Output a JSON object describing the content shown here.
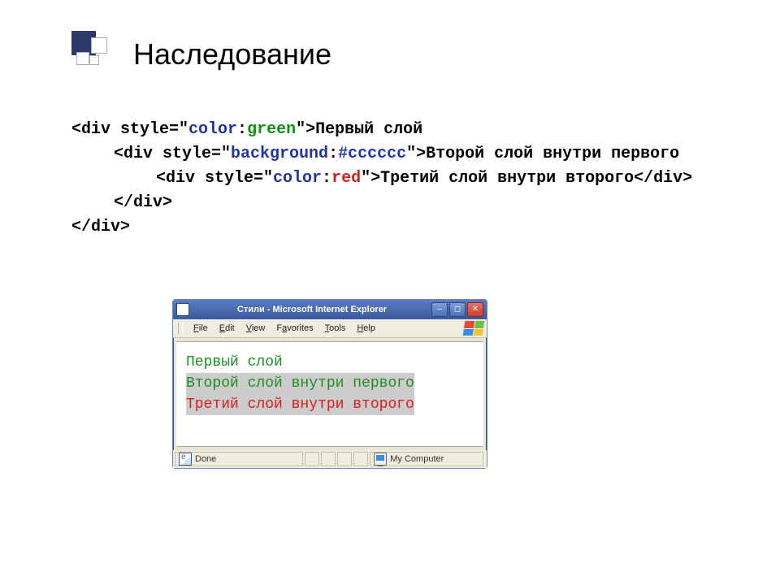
{
  "title": "Наследование",
  "code": {
    "l1_a": "<div style=\"",
    "l1_b": "color",
    "l1_c": ":",
    "l1_d": "green",
    "l1_e": "\">Первый слой",
    "l2_a": "<div style=\"",
    "l2_b": "background",
    "l2_c": ":",
    "l2_d": "#cccccc",
    "l2_e": "\">Второй слой внутри первого",
    "l3_a": "<div style=\"",
    "l3_b": "color",
    "l3_c": ":",
    "l3_d": "red",
    "l3_e": "\">Третий слой внутри второго</div>",
    "l4": "</div>",
    "l5": "</div>"
  },
  "ie": {
    "title": "Стили - Microsoft Internet Explorer",
    "menu": {
      "file": "File",
      "edit": "Edit",
      "view": "View",
      "favorites": "Favorites",
      "tools": "Tools",
      "help": "Help"
    },
    "content": {
      "line1": "Первый слой",
      "line2": "Второй слой внутри первого",
      "line3": "Третий слой внутри второго"
    },
    "status": {
      "done": "Done",
      "zone": "My Computer"
    }
  }
}
